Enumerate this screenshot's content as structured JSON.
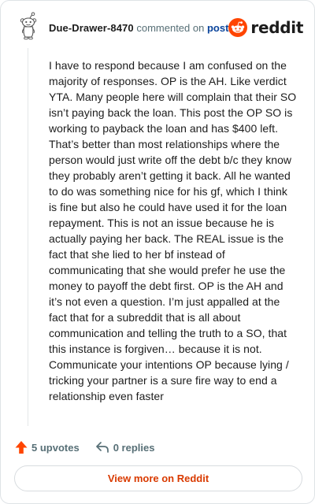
{
  "header": {
    "username": "Due-Drawer-8470",
    "action_text": "commented on",
    "post_link": "post",
    "brand_name": "reddit"
  },
  "comment": {
    "body": "I have to respond because I am confused on the majority of responses. OP is the AH. Like verdict YTA. Many people here will complain that their SO isn’t paying back the loan. This post the OP SO is working to payback the loan and has $400 left. That’s better than most relationships where the person would just write off the debt b/c they know they probably aren’t getting it back. All he wanted to do was something nice for his gf, which I think is fine but also he could have used it for the loan repayment. This is not an issue because he is actually paying her back. The REAL issue is the fact that she lied to her bf instead of communicating that she would prefer he use the money to payoff the debt first. OP is the AH and it’s not even a question. I’m just appalled at the fact that for a subreddit that is all about communication and telling the truth to a SO, that this instance is forgiven… because it is not. Communicate your intentions OP because lying / tricking your partner is a sure fire way to end a relationship even faster"
  },
  "actions": {
    "upvotes_label": "5 upvotes",
    "replies_label": "0 replies"
  },
  "footer": {
    "view_more_label": "View more on Reddit"
  },
  "icons": {
    "avatar": "snoo-avatar-icon",
    "brand": "reddit-logo-icon",
    "upvote": "upvote-arrow-icon",
    "reply": "reply-arrow-icon"
  },
  "colors": {
    "brand_orange": "#ff4500",
    "link_blue": "#0a449b",
    "view_more_text": "#d93a00",
    "muted_text": "#576f76"
  }
}
